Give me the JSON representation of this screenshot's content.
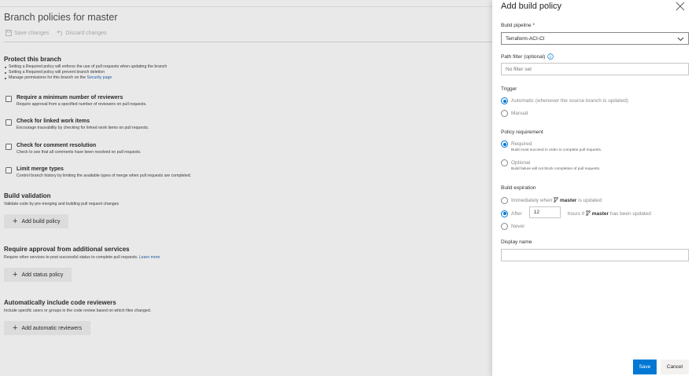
{
  "page": {
    "title": "Branch policies for master",
    "toolbar": {
      "save_label": "Save changes",
      "discard_label": "Discard changes"
    },
    "protect": {
      "heading": "Protect this branch",
      "bullets": [
        "Setting a Required policy will enforce the use of pull requests when updating the branch",
        "Setting a Required policy will prevent branch deletion",
        "Manage permissions for this branch on the"
      ],
      "security_link": "Security page"
    },
    "policies": [
      {
        "title": "Require a minimum number of reviewers",
        "desc": "Require approval from a specified number of reviewers on pull requests."
      },
      {
        "title": "Check for linked work items",
        "desc": "Encourage traceability by checking for linked work items on pull requests."
      },
      {
        "title": "Check for comment resolution",
        "desc": "Check to see that all comments have been resolved on pull requests."
      },
      {
        "title": "Limit merge types",
        "desc": "Control branch history by limiting the available types of merge when pull requests are completed."
      }
    ],
    "build_validation": {
      "heading": "Build validation",
      "desc": "Validate code by pre-merging and building pull request changes",
      "button": "Add build policy"
    },
    "additional_services": {
      "heading": "Require approval from additional services",
      "desc": "Require other services to post successful status to complete pull requests.",
      "link": "Learn more",
      "button": "Add status policy"
    },
    "reviewers": {
      "heading": "Automatically include code reviewers",
      "desc": "Include specific users or groups in the code review based on which files changed.",
      "button": "Add automatic reviewers"
    }
  },
  "panel": {
    "title": "Add build policy",
    "build_pipeline_label": "Build pipeline *",
    "build_pipeline_value": "Terraform-ACI-CI",
    "path_filter_label": "Path filter (optional)",
    "path_filter_placeholder": "No filter set",
    "trigger_label": "Trigger",
    "trigger_automatic": "Automatic (whenever the source branch is updated)",
    "trigger_manual": "Manual",
    "trigger_selected": "automatic",
    "policy_req_label": "Policy requirement",
    "required_label": "Required",
    "required_desc": "Build must succeed in order to complete pull requests.",
    "optional_label": "Optional",
    "optional_desc": "Build failure will not block completion of pull requests.",
    "policy_selected": "required",
    "expiration_label": "Build expiration",
    "exp_immediately_prefix": "Immediately when",
    "exp_branch": "master",
    "exp_immediately_suffix": "is updated",
    "exp_after_label": "After",
    "exp_hours_value": "12",
    "exp_hours_text": "hours if",
    "exp_after_suffix": "has been updated",
    "exp_never": "Never",
    "expiration_selected": "after",
    "display_name_label": "Display name",
    "display_name_value": "",
    "save_label": "Save",
    "cancel_label": "Cancel"
  },
  "colors": {
    "accent": "#0078d4",
    "link": "#1e5a9e"
  }
}
